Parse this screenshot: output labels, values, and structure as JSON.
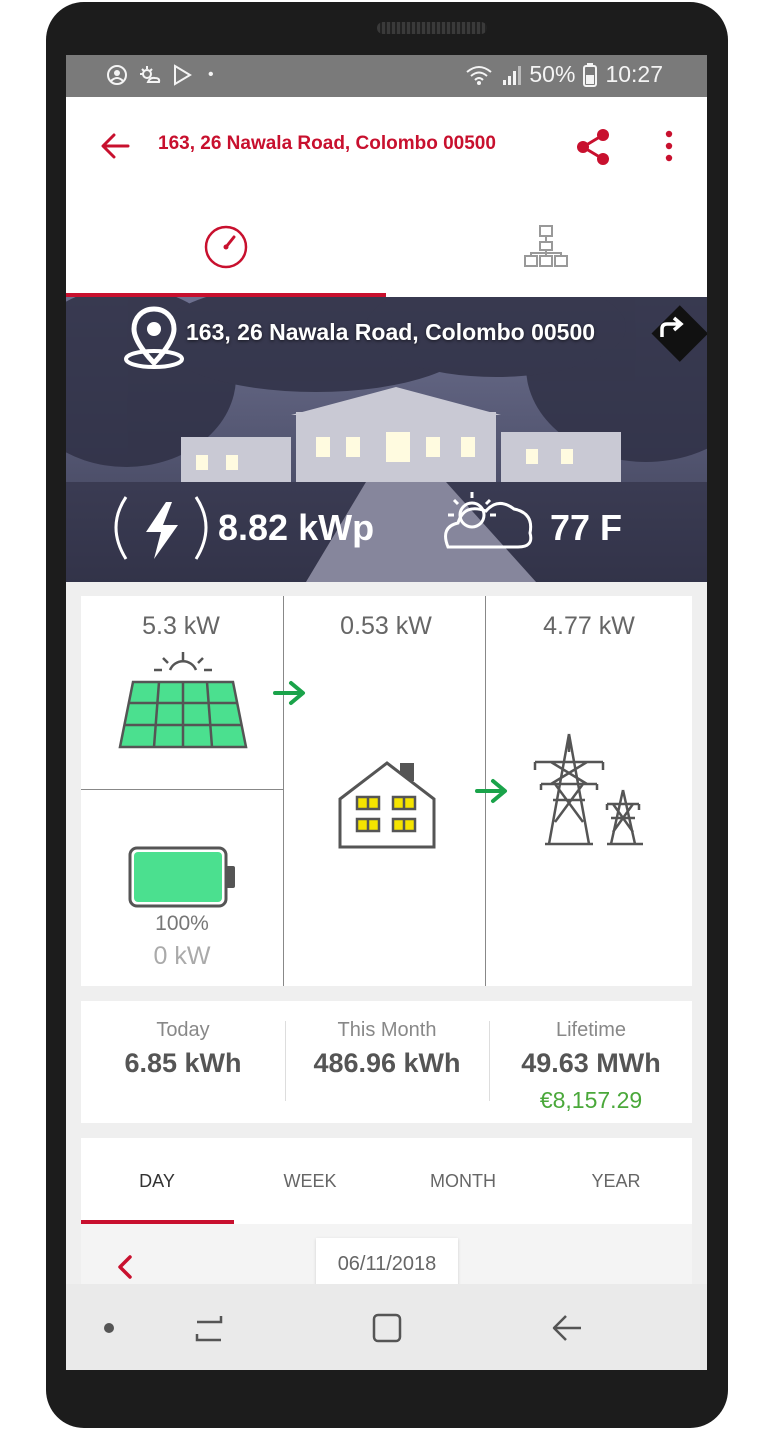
{
  "status_bar": {
    "battery": "50%",
    "time": "10:27"
  },
  "app_bar": {
    "title": "163, 26 Nawala Road, Colombo 00500"
  },
  "tabs": [
    {
      "icon": "gauge-icon"
    },
    {
      "icon": "hierarchy-icon"
    }
  ],
  "hero": {
    "address": "163, 26 Nawala Road, Colombo 00500",
    "capacity": "8.82 kWp",
    "temperature": "77 F"
  },
  "energy_flow": {
    "solar": {
      "power": "5.3 kW"
    },
    "home": {
      "power": "0.53 kW"
    },
    "grid": {
      "power": "4.77 kW"
    },
    "battery": {
      "level": 1.0,
      "percent": "100%",
      "power": "0 kW"
    }
  },
  "summary": [
    {
      "label": "Today",
      "value": "6.85 kWh"
    },
    {
      "label": "This Month",
      "value": "486.96 kWh"
    },
    {
      "label": "Lifetime",
      "value": "49.63 MWh",
      "money": "€8,157.29"
    }
  ],
  "period_tabs": [
    "DAY",
    "WEEK",
    "MONTH",
    "YEAR"
  ],
  "selected_date": "06/11/2018",
  "colors": {
    "accent": "#c8102e",
    "flow_arrow": "#1aa34a",
    "panel": "#4be08f",
    "money": "#4aa83a"
  }
}
